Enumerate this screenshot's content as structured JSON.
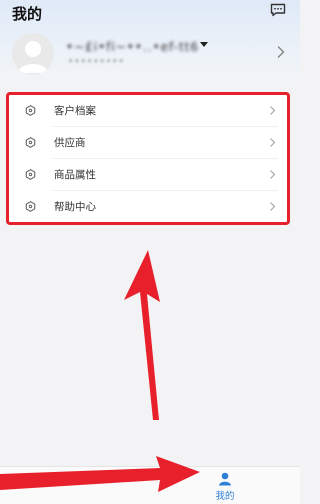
{
  "header": {
    "title": "我的",
    "message_icon": "message-icon"
  },
  "profile": {
    "username": "•~£i•fi~••..•ef-tt6",
    "user_id": "•••••••••",
    "avatar_icon": "avatar-placeholder-icon"
  },
  "menu": {
    "items": [
      {
        "label": "客户档案",
        "icon": "hexagon-icon"
      },
      {
        "label": "供应商",
        "icon": "hexagon-icon"
      },
      {
        "label": "商品属性",
        "icon": "hexagon-icon"
      },
      {
        "label": "帮助中心",
        "icon": "hexagon-icon"
      }
    ]
  },
  "tabbar": {
    "tabs": [
      {
        "label": "",
        "icon": "home-icon",
        "active": false
      },
      {
        "label": "我的",
        "icon": "user-icon",
        "active": true
      }
    ]
  },
  "colors": {
    "accent": "#2f7fd6",
    "annotation_red": "#e8202b"
  }
}
